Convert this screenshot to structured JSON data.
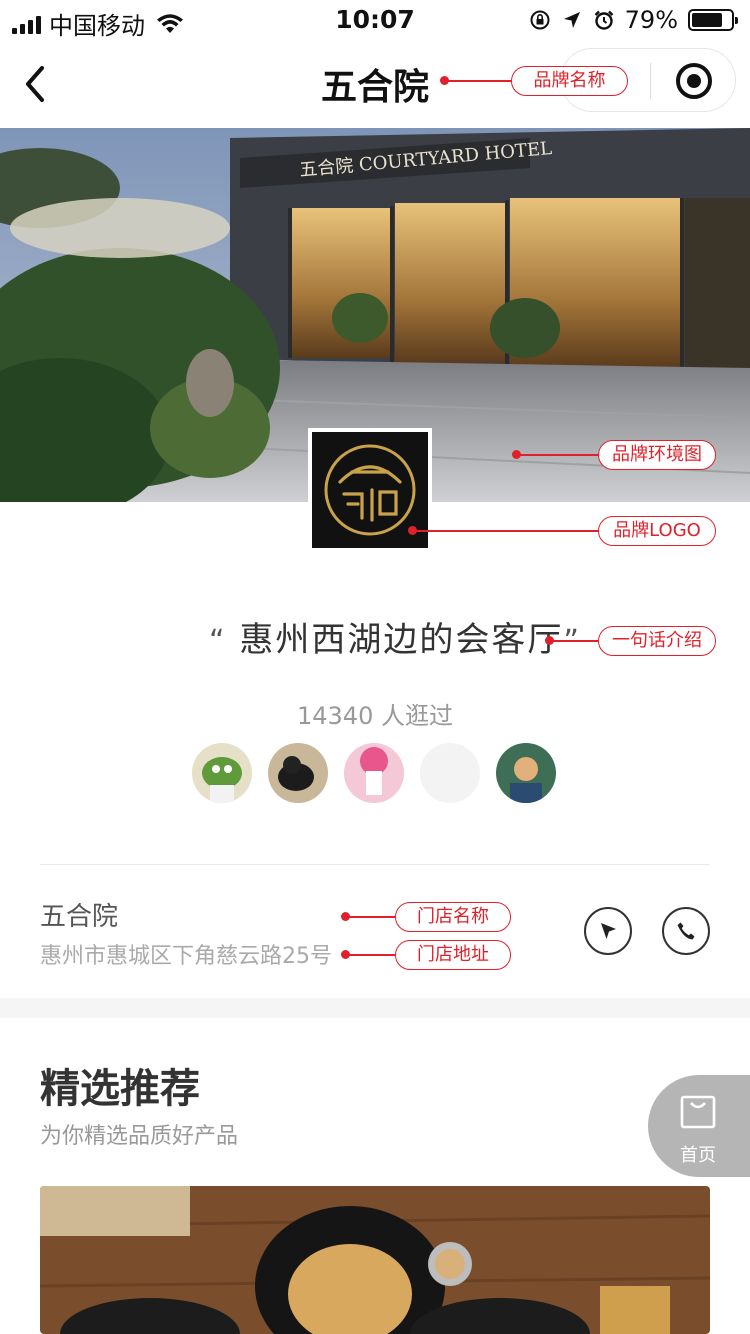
{
  "status_bar": {
    "carrier": "中国移动",
    "time": "10:07",
    "battery_pct": "79%",
    "battery_level": 0.79
  },
  "nav": {
    "title": "五合院"
  },
  "hero": {
    "sign_text": "五合院 COURTYARD HOTEL"
  },
  "brand": {
    "slogan_open": "“",
    "slogan": "惠州西湖边的会客厅",
    "slogan_close": "”",
    "visits": "14340 人逛过"
  },
  "store": {
    "name": "五合院",
    "address": "惠州市惠城区下角慈云路25号"
  },
  "recommend": {
    "title": "精选推荐",
    "subtitle": "为你精选品质好产品"
  },
  "fab": {
    "label": "首页"
  },
  "annotations": {
    "brand_name": "品牌名称",
    "brand_env": "品牌环境图",
    "brand_logo": "品牌LOGO",
    "one_line": "一句话介绍",
    "store_name": "门店名称",
    "store_addr": "门店地址"
  },
  "colors": {
    "annotation": "#e0212b",
    "text_primary": "#333333",
    "text_secondary": "#999999",
    "logo_gold": "#c9a24a"
  }
}
